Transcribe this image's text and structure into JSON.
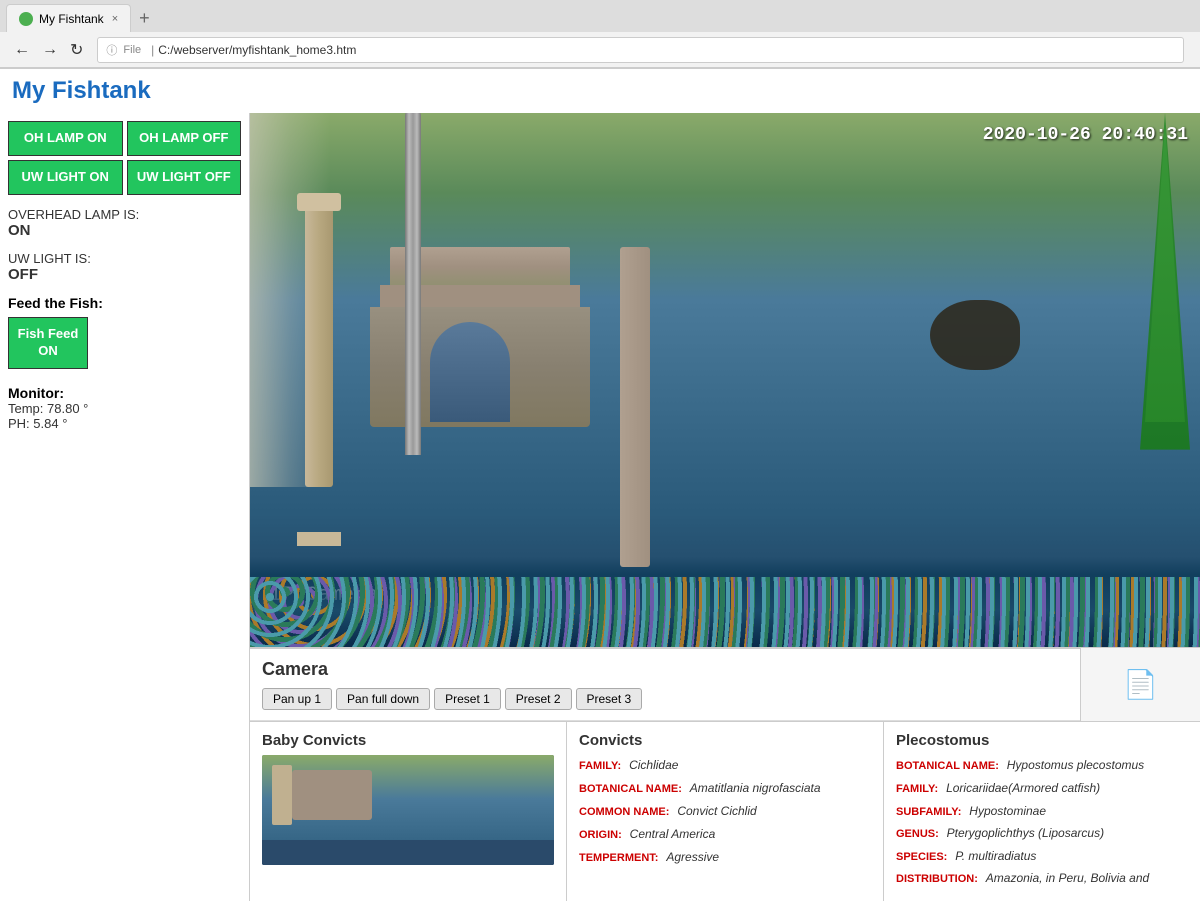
{
  "browser": {
    "tab_title": "My Fishtank",
    "tab_close": "×",
    "tab_new": "+",
    "back": "←",
    "forward": "→",
    "refresh": "↻",
    "info_icon": "ⓘ",
    "file_label": "File",
    "address": "C:/webserver/myfishtank_home3.htm"
  },
  "page": {
    "title": "My Fishtank"
  },
  "controls": {
    "oh_lamp_on": "OH LAMP ON",
    "oh_lamp_off": "OH LAMP OFF",
    "uw_light_on": "UW LIGHT ON",
    "uw_light_off": "UW LIGHT OFF",
    "overhead_label": "OVERHEAD LAMP IS:",
    "overhead_value": "ON",
    "uw_label": "UW LIGHT IS:",
    "uw_value": "OFF",
    "feed_label": "Feed the Fish:",
    "fish_feed_btn": "Fish Feed ON",
    "monitor_label": "Monitor:",
    "temp_label": "Temp: 78.80 °",
    "ph_label": "PH: 5.84 °"
  },
  "camera": {
    "timestamp": "2020-10-26 20:40:31",
    "label": "IP Camera",
    "section_title": "Camera",
    "buttons": [
      "Pan up 1",
      "Pan full down",
      "Preset 1",
      "Preset 2",
      "Preset 3"
    ]
  },
  "fish_sections": [
    {
      "title": "Baby Convicts",
      "has_image": true
    },
    {
      "title": "Convicts",
      "rows": [
        {
          "label": "FAMILY:",
          "value": "Cichlidae"
        },
        {
          "label": "BOTANICAL NAME:",
          "value": "Amatitlania nigrofasciata"
        },
        {
          "label": "COMMON NAME:",
          "value": "Convict Cichlid"
        },
        {
          "label": "ORIGIN:",
          "value": "Central America"
        },
        {
          "label": "TEMPERMENT:",
          "value": "Agressive"
        }
      ]
    },
    {
      "title": "Plecostomus",
      "rows": [
        {
          "label": "BOTANICAL NAME:",
          "value": "Hypostomus plecostomus"
        },
        {
          "label": "FAMILY:",
          "value": "Loricariidae(Armored catfish)"
        },
        {
          "label": "SUBFAMILY:",
          "value": "Hypostominae"
        },
        {
          "label": "GENUS:",
          "value": "Pterygoplichthys (Liposarcus)"
        },
        {
          "label": "SPECIES:",
          "value": "P. multiradiatus"
        },
        {
          "label": "DISTRIBUTION:",
          "value": "Amazonia, in Peru, Bolivia and"
        }
      ]
    }
  ]
}
